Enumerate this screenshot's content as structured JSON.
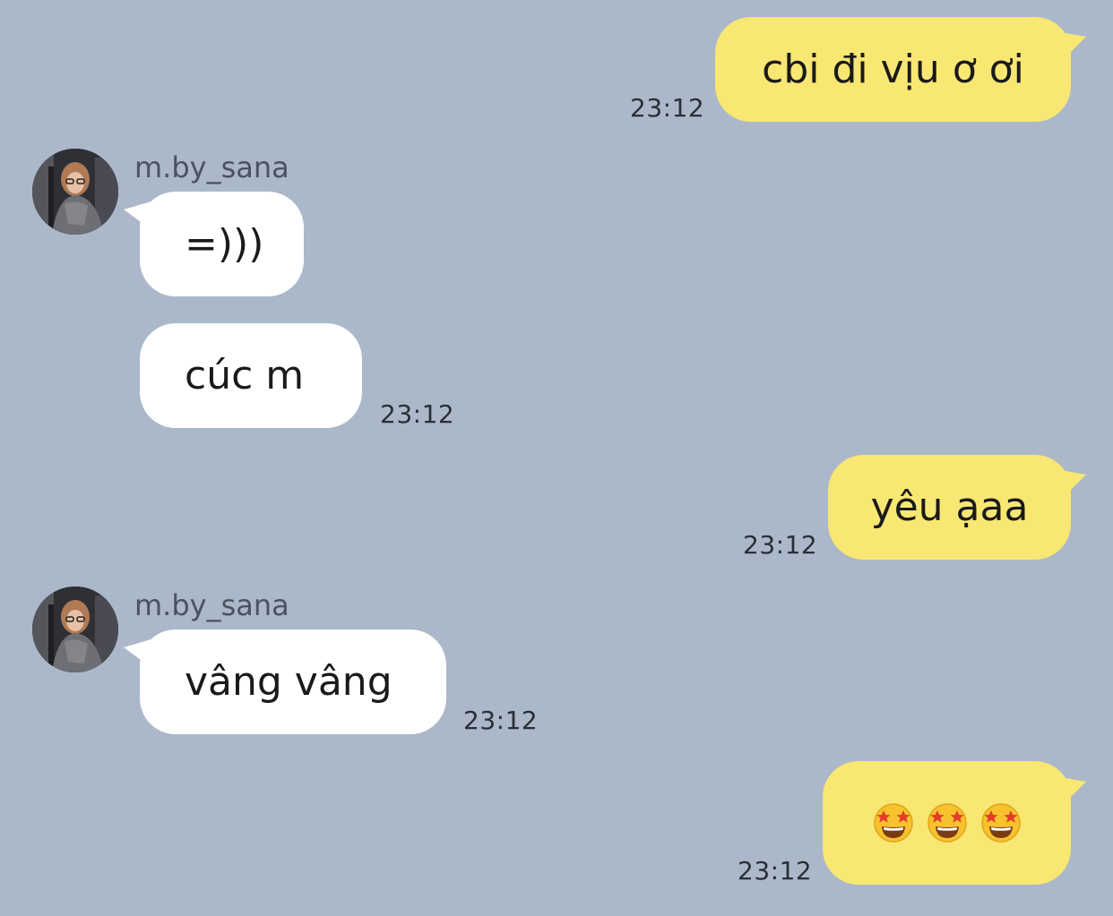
{
  "colors": {
    "background": "#abb8ca",
    "outgoing_bubble": "#f8e772",
    "incoming_bubble": "#ffffff",
    "text": "#1a1a1a",
    "timestamp": "#2a2e35",
    "sender_name": "#4b5260"
  },
  "messages": [
    {
      "direction": "outgoing",
      "text": "cbi đi vịu ơ ơi",
      "time": "23:12"
    },
    {
      "direction": "incoming",
      "sender": "m.by_sana",
      "text": "=)))"
    },
    {
      "direction": "incoming",
      "text": "cúc m",
      "time": "23:12"
    },
    {
      "direction": "outgoing",
      "text": "yêu ạaa",
      "time": "23:12"
    },
    {
      "direction": "incoming",
      "sender": "m.by_sana",
      "text": "vâng vâng",
      "time": "23:12"
    },
    {
      "direction": "outgoing",
      "emoji": [
        "star-struck-emoji",
        "star-struck-emoji",
        "star-struck-emoji"
      ],
      "time": "23:12"
    }
  ]
}
